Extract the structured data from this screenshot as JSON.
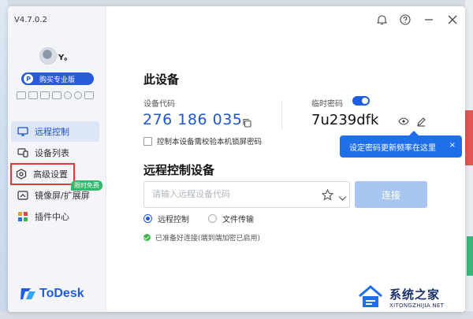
{
  "app": {
    "version": "V4.7.0.2",
    "user": "Y。",
    "pro_button": "购买专业版",
    "pro_badge": "P",
    "logo": "ToDesk"
  },
  "nav": [
    {
      "label": "远程控制",
      "icon": "monitor-icon",
      "active": true
    },
    {
      "label": "设备列表",
      "icon": "devices-icon",
      "active": false
    },
    {
      "label": "高级设置",
      "icon": "settings-icon",
      "active": false
    },
    {
      "label": "镜像屏/扩展屏",
      "icon": "mirror-icon",
      "active": false,
      "tag": "限时免费"
    },
    {
      "label": "插件中心",
      "icon": "plugin-icon",
      "active": false
    }
  ],
  "device": {
    "heading": "此设备",
    "code_label": "设备代码",
    "code": "276 186 035",
    "temp_pwd_label": "临时密码",
    "temp_pwd": "7u239dfk",
    "checkbox_label": "控制本设备需校验本机锁屏密码"
  },
  "tooltip": {
    "text": "设定密码更新频率在这里",
    "close": "×"
  },
  "remote": {
    "heading": "远程控制设备",
    "placeholder": "请输入远程设备代码",
    "connect": "连接",
    "option_remote": "远程控制",
    "option_file": "文件传输",
    "status": "已准备好连接(端到端加密已启用)"
  },
  "watermark": {
    "cn": "系统之家",
    "en": "XITONGZHIJIA.NET"
  },
  "colors": {
    "accent": "#1e5de0",
    "tooltip": "#1e6fe8",
    "highlight_box": "#e03a3a",
    "tag_green": "#33b96a"
  }
}
